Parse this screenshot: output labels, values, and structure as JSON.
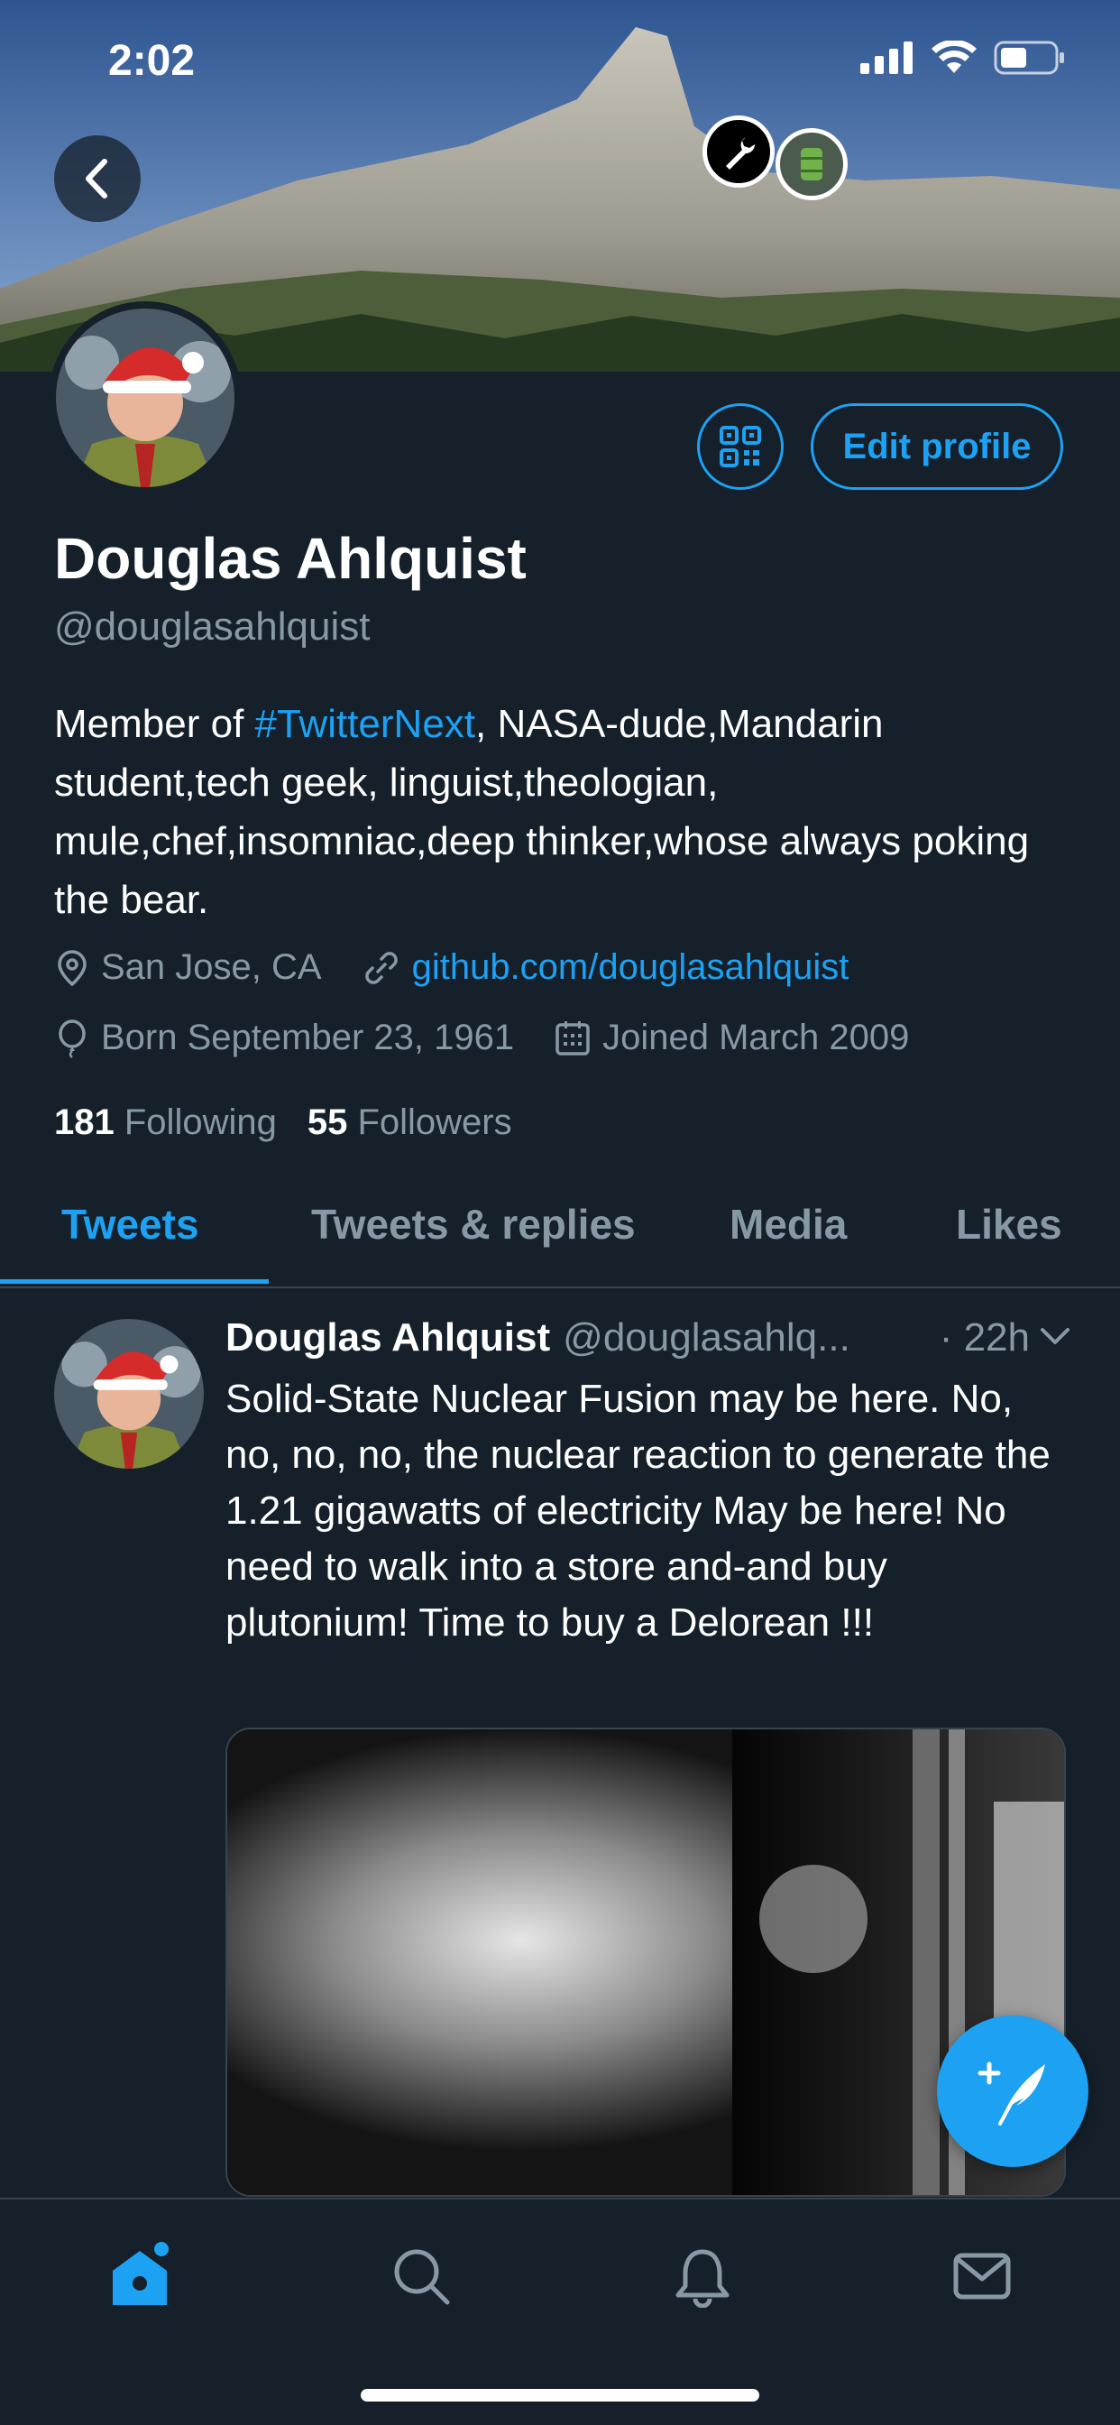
{
  "status_bar": {
    "time": "2:02"
  },
  "profile": {
    "name": "Douglas Ahlquist",
    "handle": "@douglasahlquist",
    "edit_label": "Edit profile",
    "bio_prefix": "Member of ",
    "bio_hashtag": "#TwitterNext",
    "bio_rest": ", NASA-dude,Mandarin student,tech geek, linguist,theologian, mule,chef,insomniac,deep thinker,whose always poking the bear.",
    "location": "San Jose, CA",
    "website": "github.com/douglasahlquist",
    "birthday": "Born September 23, 1961",
    "joined": "Joined March 2009",
    "following_count": "181",
    "following_label": "Following",
    "followers_count": "55",
    "followers_label": "Followers"
  },
  "tabs": [
    {
      "label": "Tweets",
      "active": true
    },
    {
      "label": "Tweets & replies",
      "active": false
    },
    {
      "label": "Media",
      "active": false
    },
    {
      "label": "Likes",
      "active": false
    }
  ],
  "tweet": {
    "name": "Douglas Ahlquist",
    "handle": "@douglasahlq...",
    "time": "· 22h",
    "text": "Solid-State Nuclear Fusion may be here.  No, no, no, no, the nuclear reaction to generate the 1.21 gigawatts of electricity May be here!  No need to walk into a store and-and buy plutonium!  Time to buy a Delorean !!!"
  },
  "colors": {
    "background": "#15202b",
    "accent": "#1da1f2",
    "secondary_text": "#8899a6",
    "divider": "#38444d"
  },
  "icons": {
    "back": "chevron-left-icon",
    "qr": "qr-code-icon",
    "location": "location-pin-icon",
    "link": "link-icon",
    "birthday": "balloon-icon",
    "joined": "calendar-icon",
    "compose": "compose-feather-icon",
    "home": "home-icon",
    "search": "search-icon",
    "notifications": "bell-icon",
    "messages": "mail-icon"
  }
}
